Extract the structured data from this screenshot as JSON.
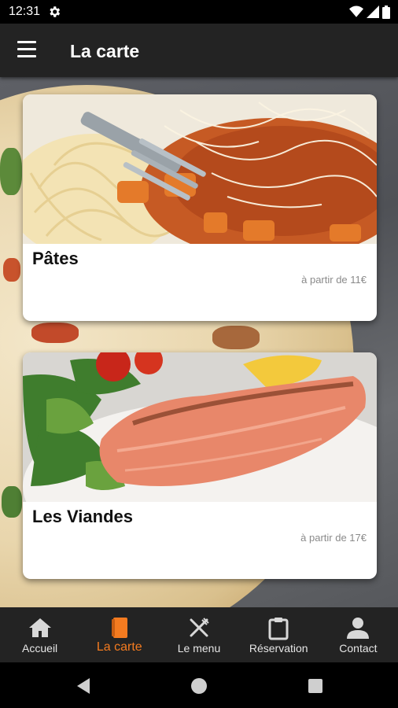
{
  "status_bar": {
    "time": "12:31"
  },
  "app_bar": {
    "title": "La carte"
  },
  "cards": [
    {
      "title": "Pâtes",
      "price": "à partir de 11€"
    },
    {
      "title": "Les Viandes",
      "price": "à partir de 17€"
    }
  ],
  "bottom_nav": {
    "items": [
      {
        "label": "Accueil",
        "icon": "home-icon"
      },
      {
        "label": "La carte",
        "icon": "book-icon",
        "active": true
      },
      {
        "label": "Le menu",
        "icon": "fork-knife-icon"
      },
      {
        "label": "Réservation",
        "icon": "clipboard-icon"
      },
      {
        "label": "Contact",
        "icon": "person-icon"
      }
    ]
  },
  "colors": {
    "accent": "#f47b20",
    "bar": "#232323",
    "card": "#ffffff"
  }
}
